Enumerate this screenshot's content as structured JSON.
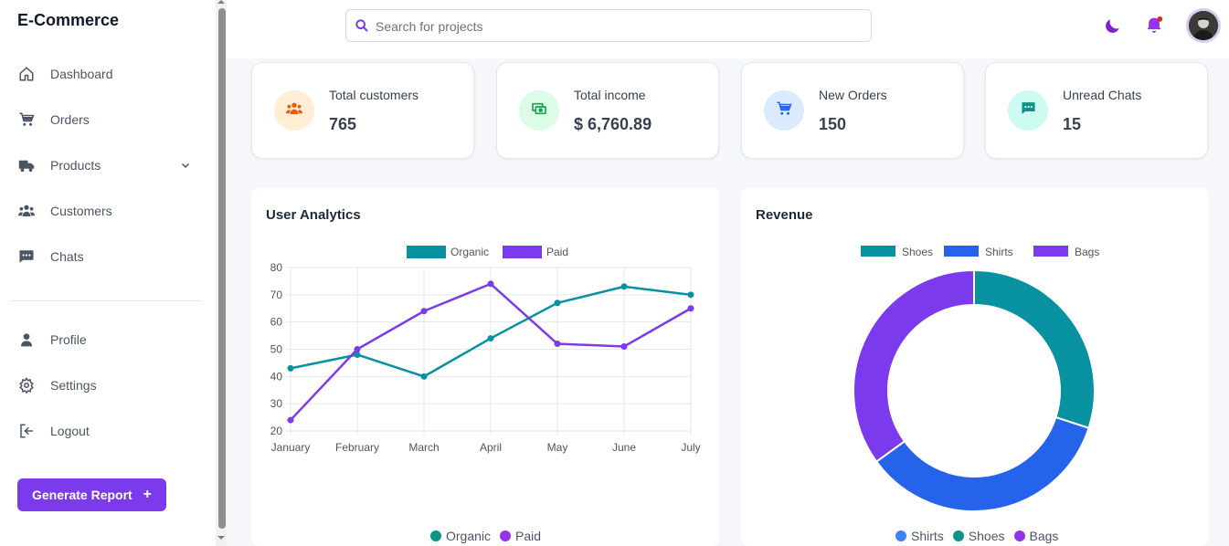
{
  "brand": "E-Commerce",
  "nav": {
    "dashboard": "Dashboard",
    "orders": "Orders",
    "products": "Products",
    "customers": "Customers",
    "chats": "Chats",
    "profile": "Profile",
    "settings": "Settings",
    "logout": "Logout"
  },
  "generate_report": {
    "label": "Generate Report",
    "icon": "+"
  },
  "search": {
    "placeholder": "Search for projects",
    "value": ""
  },
  "colors": {
    "accent": "#7c3aed",
    "teal": "#0891a0",
    "blue": "#2563eb",
    "purple": "#7c3aed",
    "notification_dot": "#dc2626"
  },
  "stats": [
    {
      "title": "Total customers",
      "value": "765",
      "icon": "users-icon",
      "icon_color": "#ea580c",
      "bg": "#ffedd5"
    },
    {
      "title": "Total income",
      "value": "$ 6,760.89",
      "icon": "money-icon",
      "icon_color": "#16a34a",
      "bg": "#dcfce7"
    },
    {
      "title": "New Orders",
      "value": "150",
      "icon": "cart-icon",
      "icon_color": "#2563eb",
      "bg": "#dbeafe"
    },
    {
      "title": "Unread Chats",
      "value": "15",
      "icon": "chat-icon",
      "icon_color": "#0d9488",
      "bg": "#ccfbf1"
    }
  ],
  "user_analytics": {
    "title": "User Analytics",
    "bottom_legend": [
      "Organic",
      "Paid"
    ]
  },
  "revenue": {
    "title": "Revenue",
    "bottom_legend": [
      "Shirts",
      "Shoes",
      "Bags"
    ]
  },
  "chart_data": [
    {
      "type": "line",
      "x": [
        "January",
        "February",
        "March",
        "April",
        "May",
        "June",
        "July"
      ],
      "series": [
        {
          "name": "Organic",
          "values": [
            43,
            48,
            40,
            54,
            67,
            73,
            70
          ],
          "color": "#0891a0"
        },
        {
          "name": "Paid",
          "values": [
            24,
            50,
            64,
            74,
            52,
            51,
            65
          ],
          "color": "#7c3aed"
        }
      ],
      "ylim": [
        20,
        80
      ],
      "yticks": [
        20,
        30,
        40,
        50,
        60,
        70,
        80
      ],
      "grid": true,
      "legend": "top-center"
    },
    {
      "type": "pie",
      "donut": true,
      "labels": [
        "Shoes",
        "Shirts",
        "Bags"
      ],
      "values": [
        30,
        35,
        35
      ],
      "colors": [
        "#0891a0",
        "#2563eb",
        "#7c3aed"
      ],
      "legend": "top-center"
    }
  ]
}
